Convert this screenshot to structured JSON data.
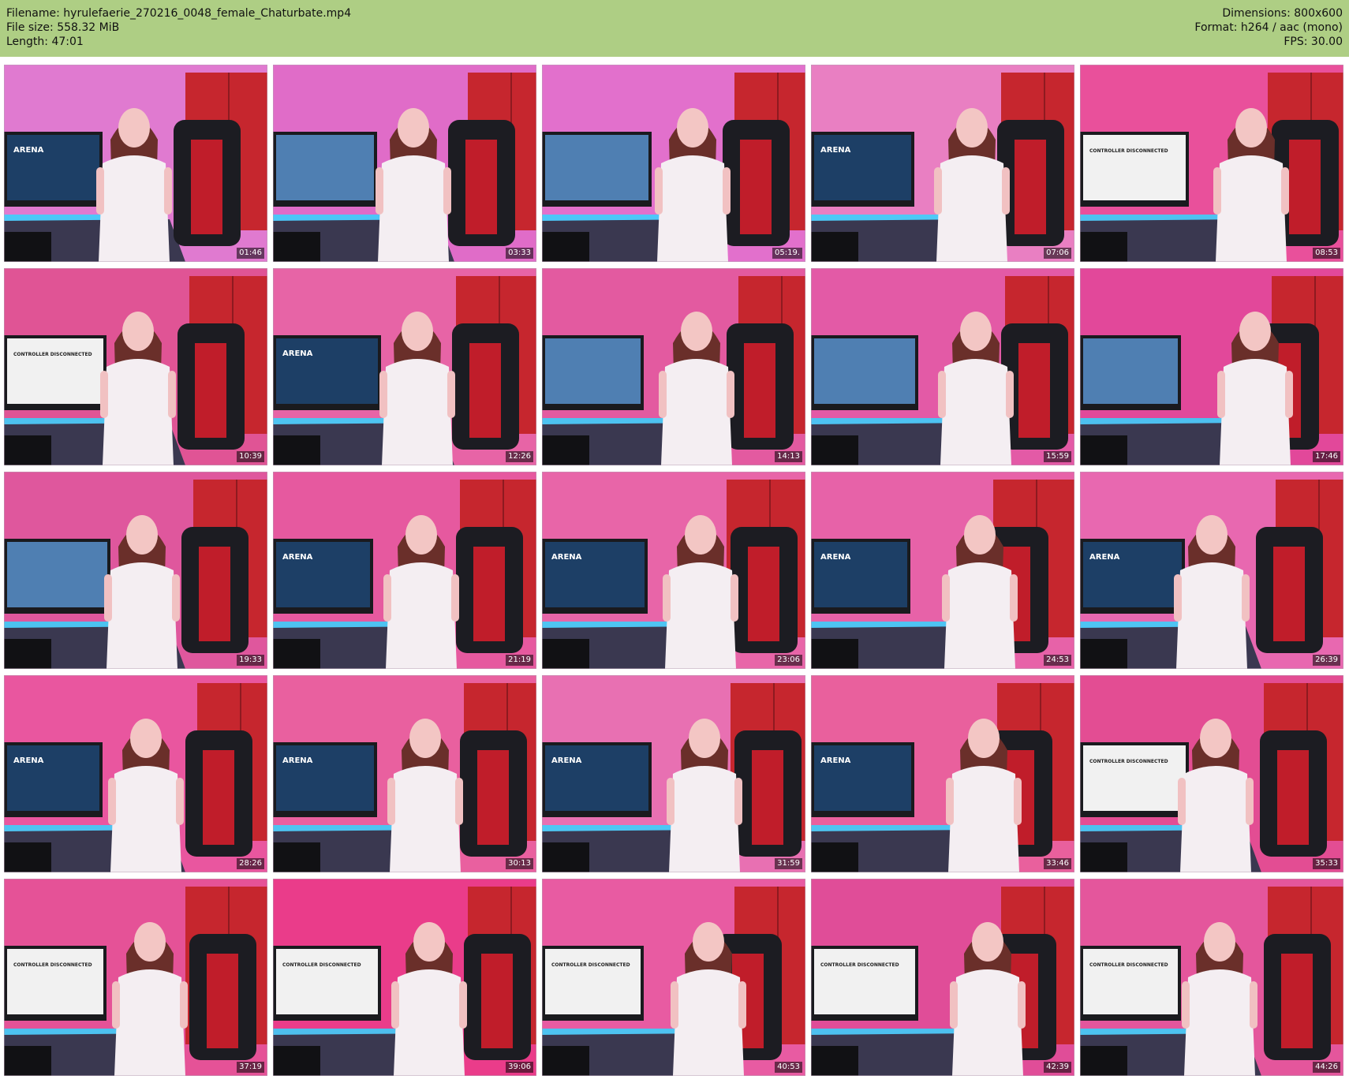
{
  "header": {
    "filename": "Filename: hyrulefaerie_270216_0048_female_Chaturbate.mp4",
    "filesize": "File size: 558.32 MiB",
    "length": "Length: 47:01",
    "dimensions": "Dimensions: 800x600",
    "format": "Format: h264 / aac (mono)",
    "fps": "FPS: 30.00"
  },
  "thumbnails": [
    {
      "time": "01:46",
      "screen": "ARENA",
      "wall": "#e07ad0"
    },
    {
      "time": "03:33",
      "screen": "",
      "wall": "#e06cc8"
    },
    {
      "time": "05:19.",
      "screen": "",
      "wall": "#e270cc"
    },
    {
      "time": "07:06",
      "screen": "ARENA",
      "wall": "#e97fc2"
    },
    {
      "time": "08:53",
      "screen": "CONTROLLER DISCONNECTED",
      "wall": "#e9509b"
    },
    {
      "time": "10:39",
      "screen": "CONTROLLER DISCONNECTED",
      "wall": "#e05495"
    },
    {
      "time": "12:26",
      "screen": "ARENA",
      "wall": "#e764a6"
    },
    {
      "time": "14:13",
      "screen": "",
      "wall": "#e35aa0"
    },
    {
      "time": "15:59",
      "screen": "",
      "wall": "#e35aa6"
    },
    {
      "time": "17:46",
      "screen": "",
      "wall": "#e2489a"
    },
    {
      "time": "19:33",
      "screen": "",
      "wall": "#df579d"
    },
    {
      "time": "21:19",
      "screen": "ARENA",
      "wall": "#e6599f"
    },
    {
      "time": "23:06",
      "screen": "ARENA",
      "wall": "#e865a8"
    },
    {
      "time": "24:53",
      "screen": "ARENA",
      "wall": "#e762a8"
    },
    {
      "time": "26:39",
      "screen": "ARENA",
      "wall": "#e868b0"
    },
    {
      "time": "28:26",
      "screen": "ARENA",
      "wall": "#e9569f"
    },
    {
      "time": "30:13",
      "screen": "ARENA",
      "wall": "#e9609f"
    },
    {
      "time": "31:59",
      "screen": "ARENA",
      "wall": "#e870b2"
    },
    {
      "time": "33:46",
      "screen": "ARENA",
      "wall": "#e9609d"
    },
    {
      "time": "35:33",
      "screen": "CONTROLLER DISCONNECTED",
      "wall": "#e34d93"
    },
    {
      "time": "37:19",
      "screen": "CONTROLLER DISCONNECTED",
      "wall": "#e55297"
    },
    {
      "time": "39:06",
      "screen": "CONTROLLER DISCONNECTED",
      "wall": "#ea3c8a"
    },
    {
      "time": "40:53",
      "screen": "CONTROLLER DISCONNECTED",
      "wall": "#e85ba2"
    },
    {
      "time": "42:39",
      "screen": "CONTROLLER DISCONNECTED",
      "wall": "#e04d98"
    },
    {
      "time": "44:26",
      "screen": "CONTROLLER DISCONNECTED",
      "wall": "#e4569c"
    }
  ]
}
